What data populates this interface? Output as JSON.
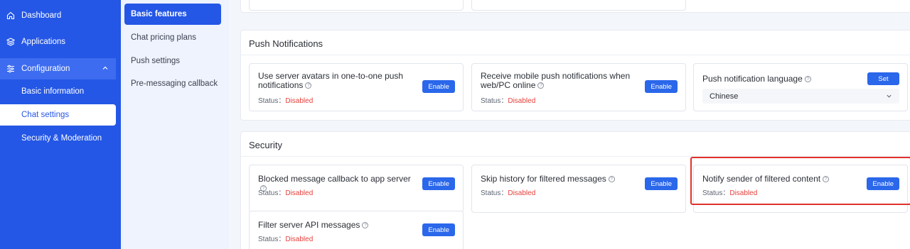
{
  "sidebar": {
    "items": [
      {
        "label": "Dashboard",
        "icon": "home-icon"
      },
      {
        "label": "Applications",
        "icon": "layers-icon"
      },
      {
        "label": "Configuration",
        "icon": "sliders-icon"
      }
    ],
    "sub_items": [
      {
        "label": "Basic information"
      },
      {
        "label": "Chat settings"
      },
      {
        "label": "Security & Moderation"
      }
    ]
  },
  "subnav": {
    "items": [
      {
        "label": "Basic features"
      },
      {
        "label": "Chat pricing plans"
      },
      {
        "label": "Push settings"
      },
      {
        "label": "Pre-messaging callback"
      }
    ]
  },
  "push": {
    "title": "Push Notifications",
    "cards": [
      {
        "title": "Use server avatars in one-to-one push notifications",
        "status_label": "Status：",
        "status_value": "Disabled",
        "button": "Enable"
      },
      {
        "title": "Receive mobile push notifications when web/PC online",
        "status_label": "Status：",
        "status_value": "Disabled",
        "button": "Enable"
      },
      {
        "title": "Push notification language",
        "button": "Set",
        "select_value": "Chinese"
      }
    ]
  },
  "security": {
    "title": "Security",
    "cards": [
      {
        "title": "Blocked message callback to app server",
        "status_label": "Status：",
        "status_value": "Disabled",
        "button": "Enable"
      },
      {
        "title": "Skip history for filtered messages",
        "status_label": "Status：",
        "status_value": "Disabled",
        "button": "Enable"
      },
      {
        "title": "Notify sender of filtered content",
        "status_label": "Status：",
        "status_value": "Disabled",
        "button": "Enable"
      },
      {
        "title": "Filter server API messages",
        "status_label": "Status：",
        "status_value": "Disabled",
        "button": "Enable"
      }
    ]
  },
  "colors": {
    "sidebar": "#2457e6",
    "button": "#2a67ea",
    "disabled": "#e5413b",
    "highlight": "#e0322b"
  }
}
